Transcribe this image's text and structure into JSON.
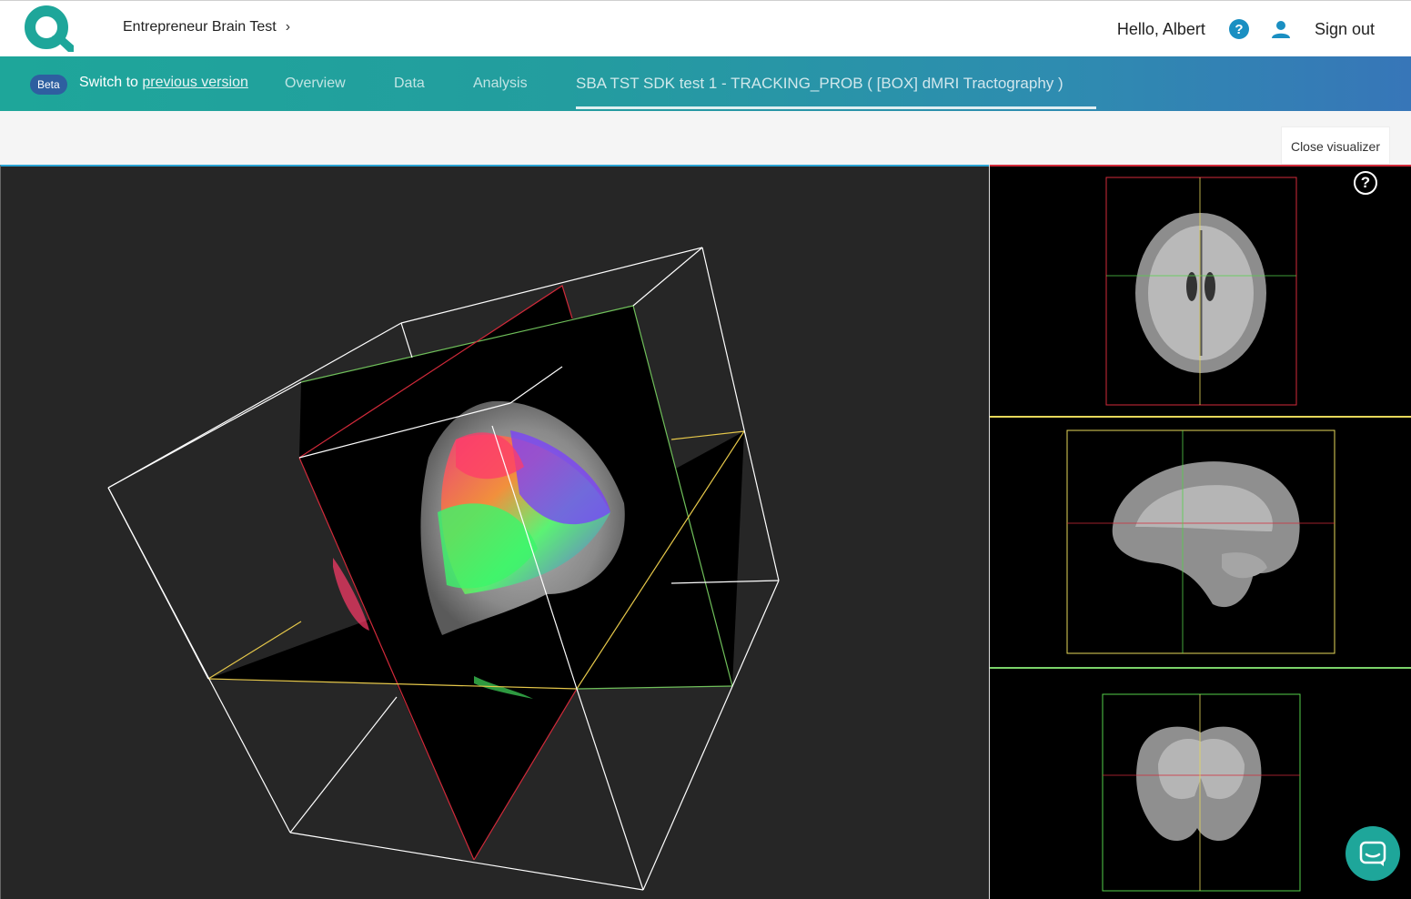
{
  "header": {
    "project": "Entrepreneur Brain Test",
    "greeting": "Hello, Albert",
    "sign_out": "Sign out"
  },
  "nav": {
    "beta_badge": "Beta",
    "switch_prefix": "Switch to ",
    "switch_link": "previous version",
    "tabs": [
      {
        "label": "Overview"
      },
      {
        "label": "Data"
      },
      {
        "label": "Analysis"
      },
      {
        "label": "SBA TST SDK test 1 - TRACKING_PROB ( [BOX] dMRI Tractography )"
      }
    ],
    "active_tab": 3
  },
  "toolbar": {
    "close_label": "Close visualizer"
  },
  "visualizer": {
    "help_glyph": "?",
    "slice_views": [
      "axial",
      "sagittal",
      "coronal"
    ],
    "colors": {
      "axial": "#d22a3a",
      "sagittal": "#e6d85a",
      "coronal": "#7bd36a",
      "bounding_box": "#ffffff",
      "view_border": "#2aa3d3"
    }
  },
  "colors": {
    "brand_teal": "#1ea69a",
    "nav_blue": "#3776b8",
    "help_blue": "#1a8fc2"
  },
  "icons": [
    "logo-icon",
    "chevron-right-icon",
    "help-icon",
    "user-icon",
    "question-icon",
    "chat-icon"
  ]
}
